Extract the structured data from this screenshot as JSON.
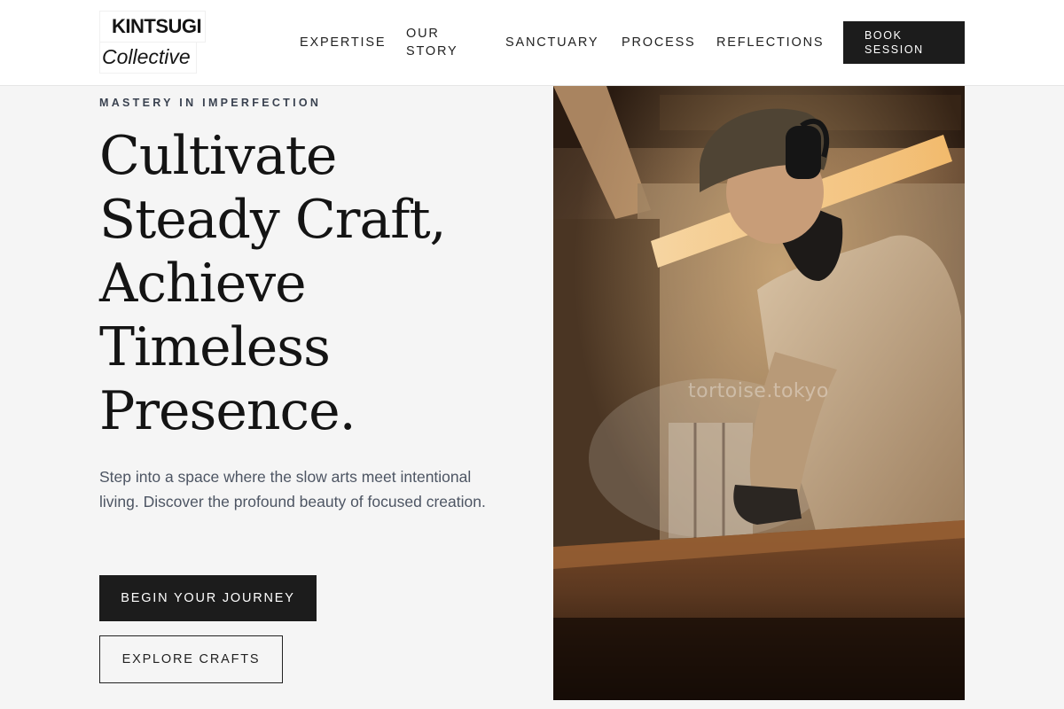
{
  "brand": {
    "line1": "KINTSUGI",
    "line2": "Collective"
  },
  "nav": {
    "items": [
      {
        "label": "EXPERTISE"
      },
      {
        "label": "OUR STORY"
      },
      {
        "label": "SANCTUARY"
      },
      {
        "label": "PROCESS"
      },
      {
        "label": "REFLECTIONS"
      }
    ],
    "cta": "BOOK SESSION"
  },
  "hero": {
    "eyebrow": "MASTERY IN IMPERFECTION",
    "headline_lines": [
      "Cultivate",
      "Steady Craft,",
      "Achieve",
      "Timeless",
      "Presence."
    ],
    "lede": "Step into a space where the slow arts meet intentional living. Discover the profound beauty of focused creation.",
    "primary_button": "BEGIN YOUR JOURNEY",
    "secondary_button": "EXPLORE CRAFTS"
  },
  "image": {
    "subject": "craftsman-at-workbench-photo",
    "watermark": "tortoise.tokyo"
  },
  "colors": {
    "background": "#f5f5f5",
    "header": "#ffffff",
    "dark": "#1c1c1c",
    "eyebrow": "#3a4250",
    "body_text": "#4d5563"
  }
}
